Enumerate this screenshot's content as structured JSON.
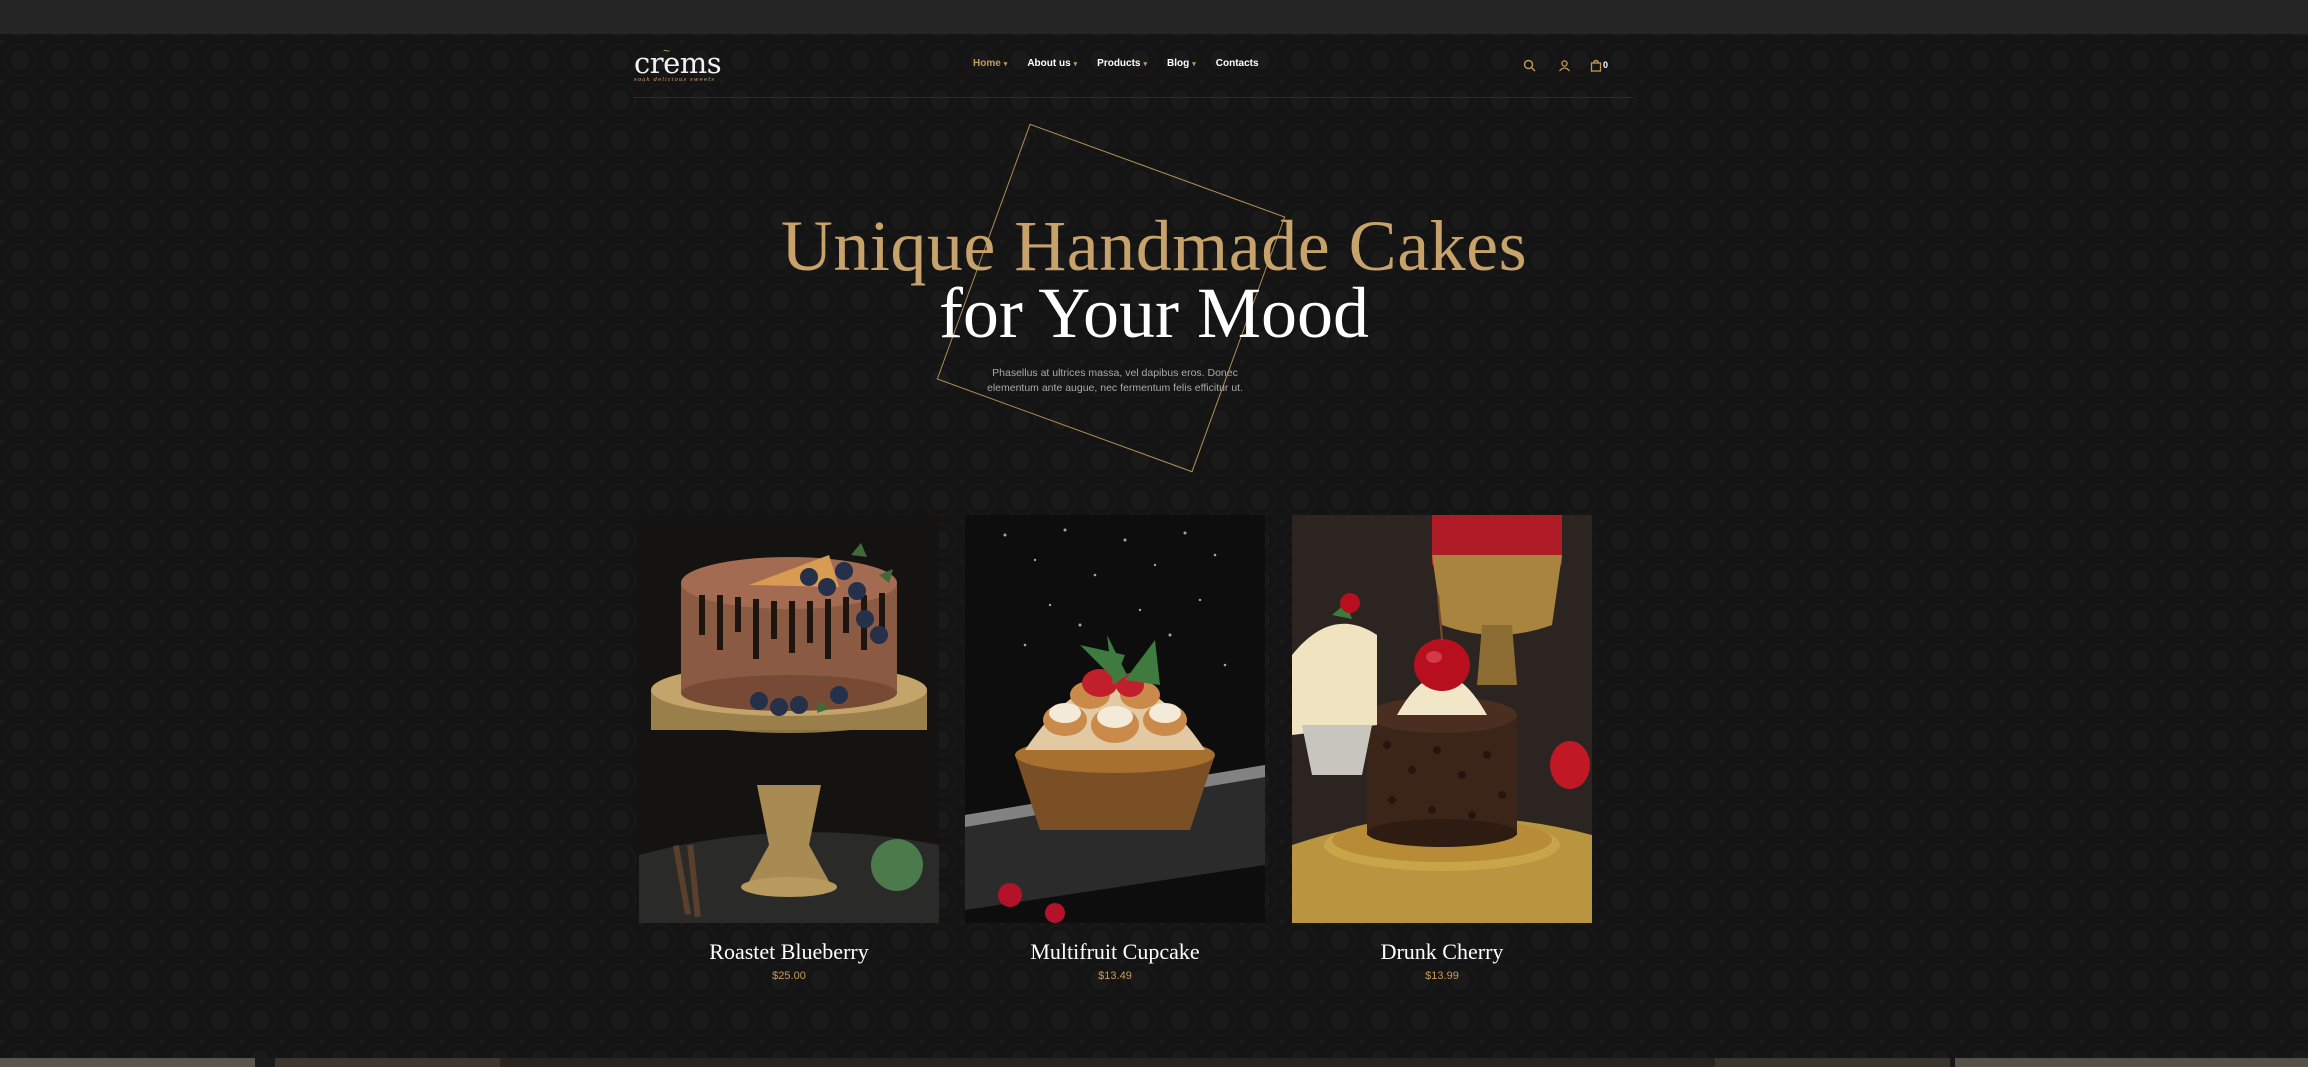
{
  "logo": {
    "word": "crems",
    "tagline": "soak delicious sweets"
  },
  "nav": {
    "items": [
      {
        "label": "Home",
        "has_dropdown": true,
        "active": true
      },
      {
        "label": "About us",
        "has_dropdown": true,
        "active": false
      },
      {
        "label": "Products",
        "has_dropdown": true,
        "active": false
      },
      {
        "label": "Blog",
        "has_dropdown": true,
        "active": false
      },
      {
        "label": "Contacts",
        "has_dropdown": false,
        "active": false
      }
    ]
  },
  "header_icons": {
    "search": "search-icon",
    "account": "user-icon",
    "cart": "cart-icon",
    "cart_count": "0"
  },
  "hero": {
    "title_line1": "Unique Handmade Cakes",
    "title_line2": "for Your Mood",
    "subtitle": "Phasellus at ultrices massa, vel dapibus eros. Donec elementum ante augue, nec fermentum felis efficitur ut."
  },
  "products": [
    {
      "name": "Roastet Blueberry",
      "price": "$25.00"
    },
    {
      "name": "Multifruit Cupcake",
      "price": "$13.49"
    },
    {
      "name": "Drunk Cherry",
      "price": "$13.99"
    }
  ],
  "colors": {
    "accent": "#c49a5c",
    "background": "#141414",
    "topbar": "#252525"
  }
}
